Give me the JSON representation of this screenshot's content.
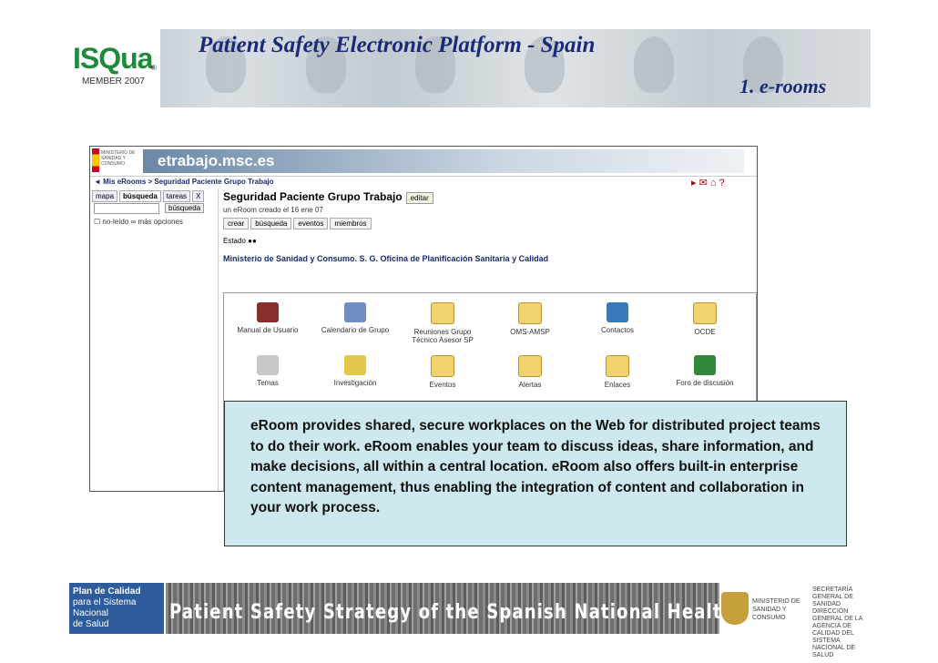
{
  "header": {
    "title": "Patient Safety Electronic Platform - Spain",
    "subtitle": "1.  e-rooms",
    "logo_text": "ISQua",
    "logo_member": "MEMBER 2007",
    "logo_reg": "®"
  },
  "screenshot": {
    "site": "etrabajo.msc.es",
    "ministry_logo": "MINISTERIO DE SANIDAD Y CONSUMO",
    "breadcrumb": "◄ Mis eRooms > Seguridad Paciente Grupo Trabajo",
    "sidebar": {
      "tabs": [
        "mapa",
        "búsqueda",
        "tareas",
        "X"
      ],
      "search_button": "búsqueda",
      "checkbox_label": "no-leído",
      "more_options": "más opciones"
    },
    "room_title": "Seguridad Paciente Grupo Trabajo",
    "edit_button": "editar",
    "created": "un eRoom creado el 16 ene 07",
    "actions": [
      "crear",
      "búsqueda",
      "eventos",
      "miembros"
    ],
    "estado_label": "Estado",
    "ministry_line": "Ministerio de Sanidad y Consumo. S. G. Oficina de Planificación Sanitaria y Calidad",
    "items": [
      {
        "label": "Manual de Usuario",
        "icon": "book-icon"
      },
      {
        "label": "Calendario de Grupo",
        "icon": "calendar-icon"
      },
      {
        "label": "Reuniones Grupo",
        "label2": "Técnico Asesor SP",
        "icon": "folder-icon"
      },
      {
        "label": "OMS-AMSP",
        "icon": "folder-icon"
      },
      {
        "label": "Contactos",
        "icon": "contacts-icon"
      },
      {
        "label": "OCDE",
        "icon": "folder-icon"
      },
      {
        "label": "Temas",
        "icon": "printer-icon"
      },
      {
        "label": "Investigación",
        "icon": "bulb-icon"
      },
      {
        "label": "Eventos",
        "icon": "folder-icon"
      },
      {
        "label": "Alertas",
        "icon": "folder-icon"
      },
      {
        "label": "Enlaces",
        "icon": "folder-icon"
      },
      {
        "label": "Foro de discusión",
        "icon": "forum-icon"
      }
    ]
  },
  "callout": {
    "text": "eRoom provides shared, secure workplaces on the Web for distributed project teams to do their work. eRoom enables your team to discuss ideas, share information, and make decisions, all within a central location. eRoom also offers built-in enterprise content management, thus enabling the integration of content and collaboration in your work process."
  },
  "footer": {
    "plan_line1": "Plan de Calidad",
    "plan_line2": "para el Sistema Nacional",
    "plan_line3": "de Salud",
    "strategy": "Patient Safety Strategy of the Spanish National Health System",
    "ministry": "MINISTERIO DE SANIDAD Y CONSUMO",
    "secretaria": "SECRETARÍA GENERAL DE SANIDAD",
    "agency": "DIRECCIÓN GENERAL DE LA AGENCIA DE CALIDAD DEL SISTEMA NACIONAL DE SALUD"
  }
}
